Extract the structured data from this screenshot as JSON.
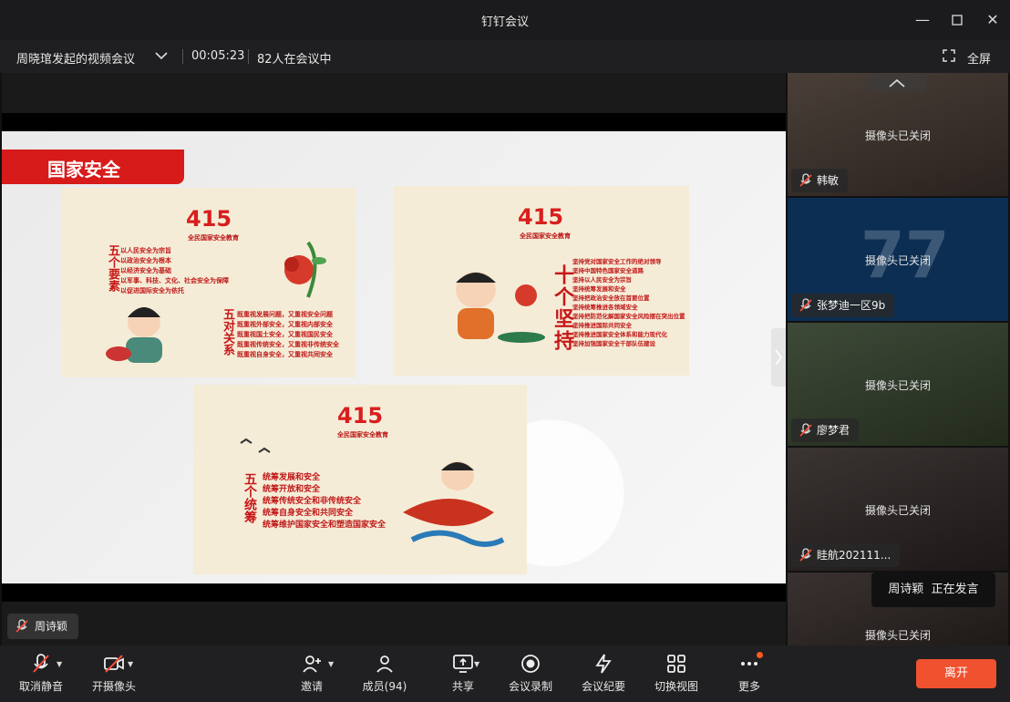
{
  "window": {
    "title": "钉钉会议"
  },
  "infobar": {
    "meeting_name": "周晓琯发起的视频会议",
    "duration": "00:05:23",
    "participants_in_meeting": "82人在会议中",
    "fullscreen_label": "全屏"
  },
  "slide": {
    "banner": "国家安全",
    "panels": [
      {
        "logo": "415",
        "logo_sub": "全民国家安全教育",
        "title_a": "五个要素",
        "lines_a": [
          "以人民安全为宗旨",
          "以政治安全为根本",
          "以经济安全为基础",
          "以军事、科技、文化、社会安全为保障",
          "以促进国际安全为依托"
        ],
        "title_b": "五对关系",
        "lines_b": [
          "既重视发展问题，又重视安全问题",
          "既重视外部安全，又重视内部安全",
          "既重视国土安全，又重视国民安全",
          "既重视传统安全，又重视非传统安全",
          "既重视自身安全，又重视共同安全"
        ]
      },
      {
        "logo": "415",
        "logo_sub": "全民国家安全教育",
        "title": "十个坚持",
        "lines": [
          "坚持党对国家安全工作的绝对领导",
          "坚持中国特色国家安全道路",
          "坚持以人民安全为宗旨",
          "坚持统筹发展和安全",
          "坚持把政治安全放在首要位置",
          "坚持统筹推进各领域安全",
          "坚持把防范化解国家安全风险摆在突出位置",
          "坚持推进国际共同安全",
          "坚持推进国家安全体系和能力现代化",
          "坚持加强国家安全干部队伍建设"
        ]
      },
      {
        "logo": "415",
        "logo_sub": "全民国家安全教育",
        "title": "五个统筹",
        "lines": [
          "统筹发展和安全",
          "统筹开放和安全",
          "统筹传统安全和非传统安全",
          "统筹自身安全和共同安全",
          "统筹维护国家安全和塑造国家安全"
        ]
      }
    ]
  },
  "participants": [
    {
      "name": "韩敏",
      "status": "摄像头已关闭"
    },
    {
      "name": "张梦迪一区9b",
      "status": "摄像头已关闭",
      "watermark": "77"
    },
    {
      "name": "廖梦君",
      "status": "摄像头已关闭"
    },
    {
      "name": "眭航202111...",
      "status": "摄像头已关闭"
    },
    {
      "name": "",
      "status": "摄像头已关闭"
    }
  ],
  "speaking": {
    "name": "周诗颖",
    "label": "正在发言"
  },
  "self_name": "周诗颖",
  "toolbar": {
    "unmute": "取消静音",
    "camera": "开摄像头",
    "invite": "邀请",
    "members": "成员(94)",
    "share": "共享",
    "record": "会议录制",
    "minutes": "会议纪要",
    "switch_view": "切换视图",
    "more": "更多",
    "leave": "离开"
  },
  "colors": {
    "accent_red": "#d71a1a",
    "leave": "#f0512f",
    "toolbar_bg": "#202022"
  }
}
